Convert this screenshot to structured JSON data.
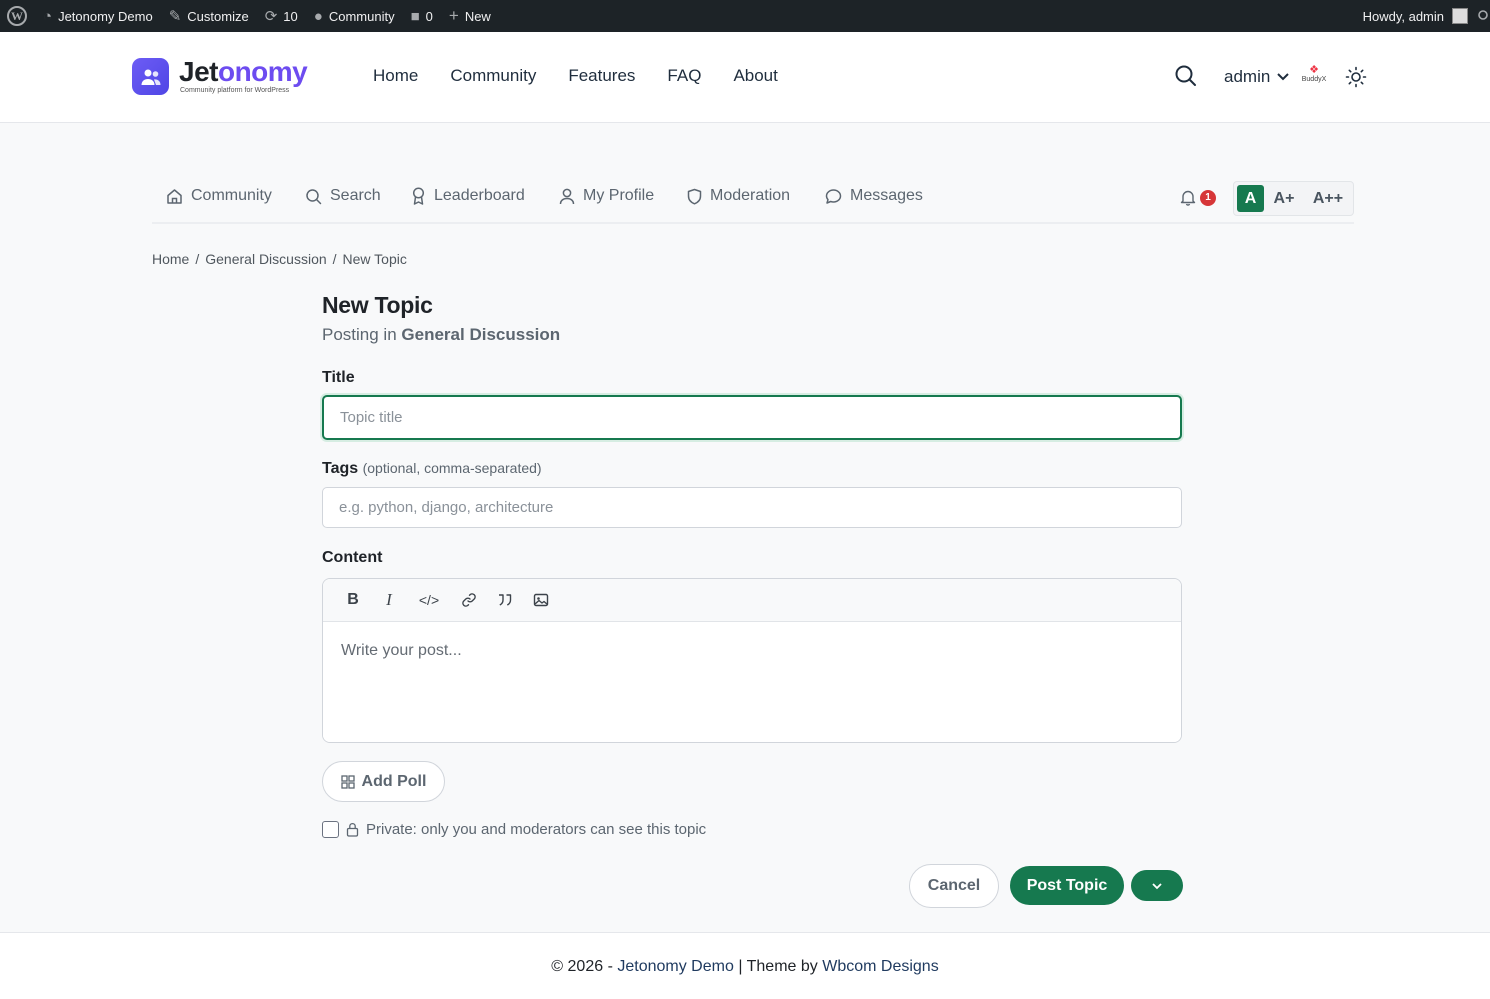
{
  "adminbar": {
    "site_name": "Jetonomy Demo",
    "customize": "Customize",
    "updates_count": "10",
    "community": "Community",
    "comments_count": "0",
    "new": "New",
    "howdy": "Howdy, admin"
  },
  "header": {
    "logo_text_a": "Jet",
    "logo_text_b": "onomy",
    "logo_tagline": "Community platform for WordPress",
    "nav": [
      "Home",
      "Community",
      "Features",
      "FAQ",
      "About"
    ],
    "user_menu": "admin",
    "buddyx_label": "BuddyX"
  },
  "community_nav": {
    "items": [
      "Community",
      "Search",
      "Leaderboard",
      "My Profile",
      "Moderation",
      "Messages"
    ],
    "notification_count": "1",
    "font_sizes": [
      "A",
      "A+",
      "A++"
    ]
  },
  "breadcrumb": {
    "items": [
      "Home",
      "General Discussion",
      "New Topic"
    ],
    "separator": "/"
  },
  "form": {
    "page_title": "New Topic",
    "posting_in_prefix": "Posting in",
    "posting_in_forum": "General Discussion",
    "title_label": "Title",
    "title_placeholder": "Topic title",
    "tags_label": "Tags",
    "tags_hint": "(optional, comma-separated)",
    "tags_placeholder": "e.g. python, django, architecture",
    "content_label": "Content",
    "content_placeholder": "Write your post...",
    "add_poll": "Add Poll",
    "private_label": "Private: only you and moderators can see this topic",
    "cancel": "Cancel",
    "submit": "Post Topic"
  },
  "footer": {
    "prefix": "© 2026 -",
    "site": "Jetonomy Demo",
    "middle": "| Theme by",
    "theme_author": "Wbcom Designs"
  },
  "colors": {
    "primary": "#16794f",
    "admin_bar": "#1d2327",
    "logo_accent": "#6d4cf0",
    "notification_badge": "#d63638"
  }
}
